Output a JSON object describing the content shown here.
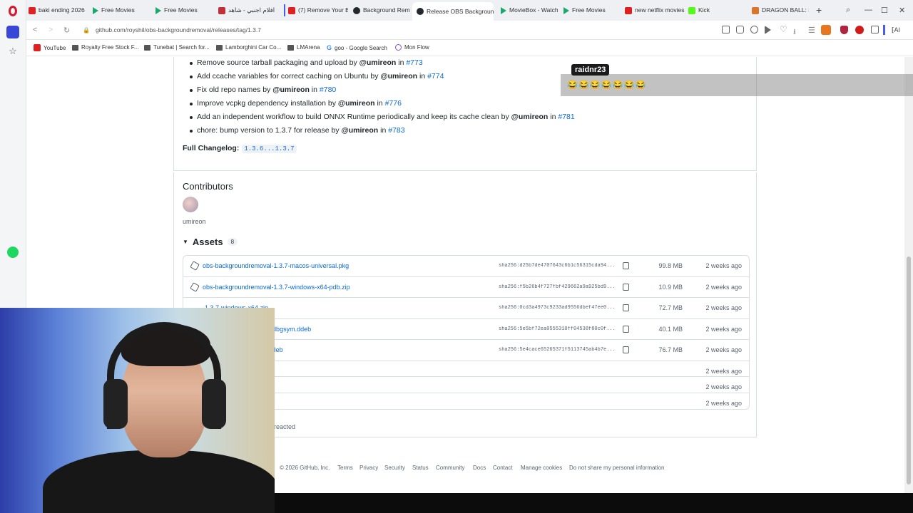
{
  "tabs": [
    {
      "label": "baki ending 2026",
      "icon": "youtube-icon"
    },
    {
      "label": "Free Movies",
      "icon": "play-icon"
    },
    {
      "label": "Free Movies",
      "icon": "play-icon"
    },
    {
      "label": "افلام اجنبي - شاهد",
      "icon": "site-icon"
    },
    {
      "label": "(7) Remove Your B",
      "icon": "youtube-icon"
    },
    {
      "label": "Background Remo",
      "icon": "github-icon"
    },
    {
      "label": "Release OBS Background",
      "icon": "github-icon"
    },
    {
      "label": "MovieBox - Watch",
      "icon": "play-icon"
    },
    {
      "label": "Free Movies",
      "icon": "play-icon"
    },
    {
      "label": "new netflix movies",
      "icon": "youtube-icon"
    },
    {
      "label": "Kick",
      "icon": "kick-icon"
    },
    {
      "label": "DRAGON BALL: Sp",
      "icon": "site-icon"
    }
  ],
  "address": {
    "url": "github.com/royshil/obs-backgroundremoval/releases/tag/1.3.7"
  },
  "bookmarks": [
    "YouTube",
    "Royalty Free Stock F...",
    "Tunebat | Search for...",
    "Lamborghini Car Co...",
    "LMArena",
    "goo - Google Search",
    "Mon Flow"
  ],
  "changes": [
    {
      "text": "Remove source tarball packaging and upload by ",
      "user": "@umireon",
      "mid": " in ",
      "pr": "#773"
    },
    {
      "text": "Add ccache variables for correct caching on Ubuntu by ",
      "user": "@umireon",
      "mid": " in ",
      "pr": "#774"
    },
    {
      "text": "Fix old repo names by ",
      "user": "@umireon",
      "mid": " in ",
      "pr": "#780"
    },
    {
      "text": "Improve vcpkg dependency installation by ",
      "user": "@umireon",
      "mid": " in ",
      "pr": "#776"
    },
    {
      "text": "Add an independent workflow to build ONNX Runtime periodically and keep its cache clean by ",
      "user": "@umireon",
      "mid": " in ",
      "pr": "#781"
    },
    {
      "text": "chore: bump version to 1.3.7 for release by ",
      "user": "@umireon",
      "mid": " in ",
      "pr": "#783"
    }
  ],
  "changelog": {
    "label": "Full Changelog:",
    "range": "1.3.6...1.3.7"
  },
  "contributors": {
    "title": "Contributors",
    "name": "umireon"
  },
  "assets": {
    "title": "Assets",
    "count": "8",
    "rows": [
      {
        "name": "obs-backgroundremoval-1.3.7-macos-universal.pkg",
        "sha": "sha256:d25b7de4707643c6b1c56315cda94...",
        "size": "99.8 MB",
        "date": "2 weeks ago"
      },
      {
        "name": "obs-backgroundremoval-1.3.7-windows-x64-pdb.zip",
        "sha": "sha256:f5b26b4f727fbf429662a9a925bd9...",
        "size": "10.9 MB",
        "date": "2 weeks ago"
      },
      {
        "name": "-1.3.7-windows-x64.zip",
        "sha": "sha256:0cd3a4973c9233ad9556dbef47ee0...",
        "size": "72.7 MB",
        "date": "2 weeks ago"
      },
      {
        "name": "-1.3.7-x86_64-linux-gnu-dbgsym.ddeb",
        "sha": "sha256:5e5bf72ea0555310ff04538f80c0f...",
        "size": "40.1 MB",
        "date": "2 weeks ago"
      },
      {
        "name": "-1.3.7-x86_64-linux-gnu.deb",
        "sha": "sha256:5e4cace65265371f5113745ab4b7e...",
        "size": "76.7 MB",
        "date": "2 weeks ago"
      },
      {
        "name": "",
        "sha": "",
        "size": "",
        "date": "2 weeks ago"
      },
      {
        "name": "",
        "sha": "",
        "size": "",
        "date": "2 weeks ago"
      },
      {
        "name": ")",
        "sha": "",
        "size": "",
        "date": "2 weeks ago"
      }
    ]
  },
  "reacted": "reacted",
  "footer": [
    "© 2026 GitHub, Inc.",
    "Terms",
    "Privacy",
    "Security",
    "Status",
    "Community",
    "Docs",
    "Contact",
    "Manage cookies",
    "Do not share my personal information"
  ],
  "chat": {
    "username": "raidnr23",
    "message": "😂😂😂😂😂😂😂"
  }
}
